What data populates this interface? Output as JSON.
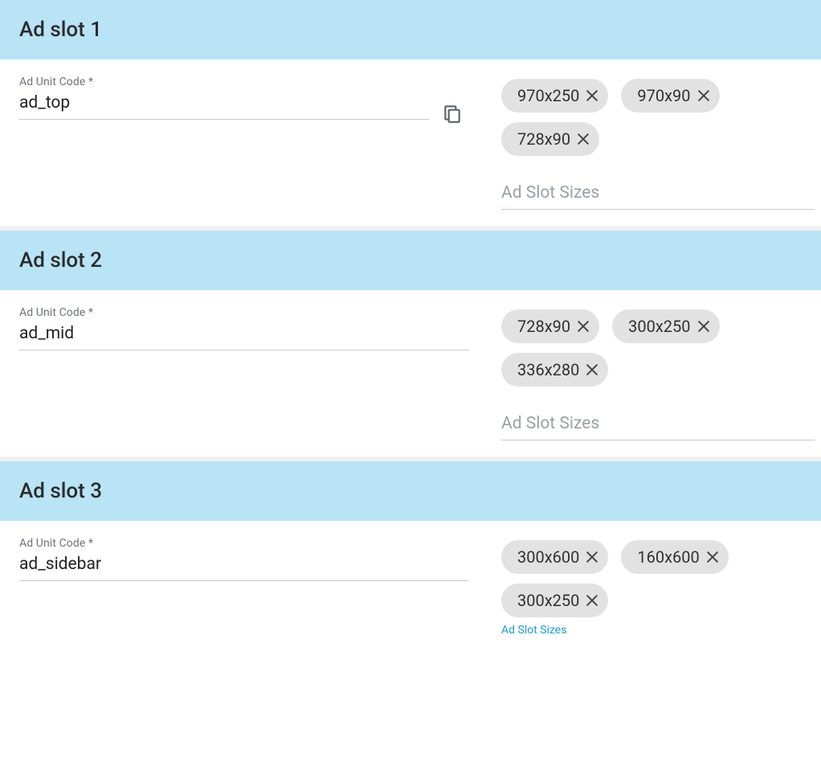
{
  "labels": {
    "ad_unit_code": "Ad Unit Code *",
    "ad_slot_sizes_placeholder": "Ad Slot Sizes",
    "ad_slot_sizes_focused": "Ad Slot Sizes"
  },
  "slots": [
    {
      "title": "Ad slot 1",
      "code": "ad_top",
      "show_copy": true,
      "sizes": [
        "970x250",
        "970x90",
        "728x90"
      ],
      "sizes_focused": false
    },
    {
      "title": "Ad slot 2",
      "code": "ad_mid",
      "show_copy": false,
      "sizes": [
        "728x90",
        "300x250",
        "336x280"
      ],
      "sizes_focused": false
    },
    {
      "title": "Ad slot 3",
      "code": "ad_sidebar",
      "show_copy": false,
      "sizes": [
        "300x600",
        "160x600",
        "300x250"
      ],
      "sizes_focused": true
    }
  ]
}
